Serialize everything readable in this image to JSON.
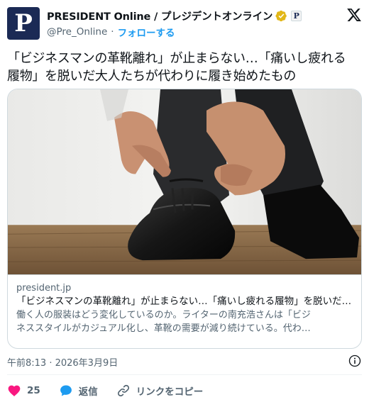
{
  "author": {
    "avatar_letter": "P",
    "name": "PRESIDENT Online / プレジデントオンライン",
    "affiliate_badge_letter": "P",
    "handle": "@Pre_Online",
    "separator": "·",
    "follow_label": "フォローする",
    "verified_color": "#e2b719"
  },
  "tweet": {
    "text_line1": "「ビジネスマンの革靴離れ」が止まらない…「痛いし疲れる",
    "text_line2": "履物」を脱いだ大人たちが代わりに履き始めたもの"
  },
  "card": {
    "image_subject": "man tying black leather oxford shoe",
    "domain": "president.jp",
    "title": "「ビジネスマンの革靴離れ」が止まらない…「痛いし疲れる履物」を脱いだ…",
    "desc_line1": "働く人の服装はどう変化しているのか。ライターの南充浩さんは「ビジ",
    "desc_line2": "ネススタイルがカジュアル化し、革靴の需要が減り続けている。代わ…"
  },
  "meta": {
    "timestamp": "午前8:13 · 2026年3月9日"
  },
  "actions": {
    "like_count": "25",
    "reply_label": "返信",
    "copy_link_label": "リンクをコピー",
    "like_color": "#f91880",
    "reply_color": "#1d9bf0"
  }
}
